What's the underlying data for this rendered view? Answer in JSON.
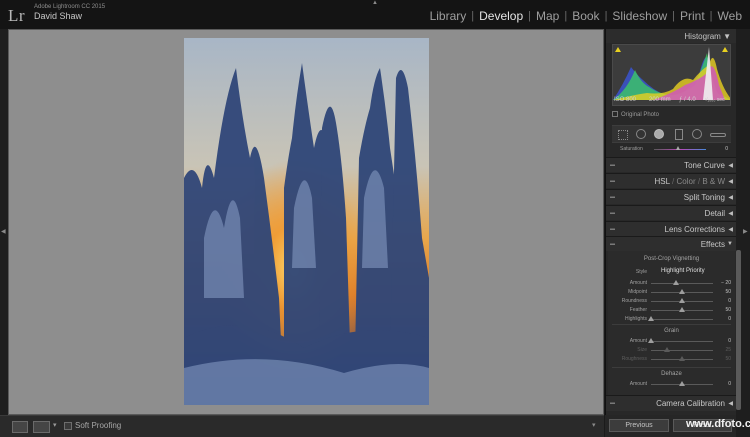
{
  "app": {
    "logo": "Lr",
    "product": "Adobe Lightroom CC 2015",
    "user": "David Shaw"
  },
  "modules": [
    "Library",
    "Develop",
    "Map",
    "Book",
    "Slideshow",
    "Print",
    "Web"
  ],
  "active_module": "Develop",
  "toolbar": {
    "soft_proofing": "Soft Proofing"
  },
  "histogram": {
    "title": "Histogram",
    "iso": "ISO 800",
    "focal": "200 mm",
    "aperture": "ƒ / 4.0",
    "shutter": "¹⁄₁₀₀₀ sec",
    "original_photo": "Original Photo"
  },
  "partial_row": {
    "label": "Saturation",
    "value": "0"
  },
  "sections": {
    "tone_curve": "Tone Curve",
    "hsl": {
      "hsl": "HSL",
      "color": "Color",
      "bw": "B & W"
    },
    "split_toning": "Split Toning",
    "detail": "Detail",
    "lens_corrections": "Lens Corrections",
    "effects": "Effects",
    "camera_calibration": "Camera Calibration"
  },
  "effects": {
    "vignette_title": "Post-Crop Vignetting",
    "style_label": "Style",
    "style_value": "Highlight Priority",
    "vignette_sliders": [
      {
        "label": "Amount",
        "value": "− 20",
        "pos": 0.4
      },
      {
        "label": "Midpoint",
        "value": "50",
        "pos": 0.5
      },
      {
        "label": "Roundness",
        "value": "0",
        "pos": 0.5
      },
      {
        "label": "Feather",
        "value": "50",
        "pos": 0.5
      },
      {
        "label": "Highlights",
        "value": "0",
        "pos": 0.0
      }
    ],
    "grain_title": "Grain",
    "grain_sliders": [
      {
        "label": "Amount",
        "value": "0",
        "pos": 0.0
      },
      {
        "label": "Size",
        "value": "25",
        "pos": 0.25
      },
      {
        "label": "Roughness",
        "value": "50",
        "pos": 0.5
      }
    ],
    "dehaze_title": "Dehaze",
    "dehaze_slider": {
      "label": "Amount",
      "value": "0",
      "pos": 0.5
    }
  },
  "bottom": {
    "previous": "Previous",
    "reset": "Reset"
  },
  "watermark": "www.dfoto.com",
  "colors": {
    "canvas": "#8e8e8e",
    "panel": "#282828",
    "active_text": "#e4e4e4"
  }
}
